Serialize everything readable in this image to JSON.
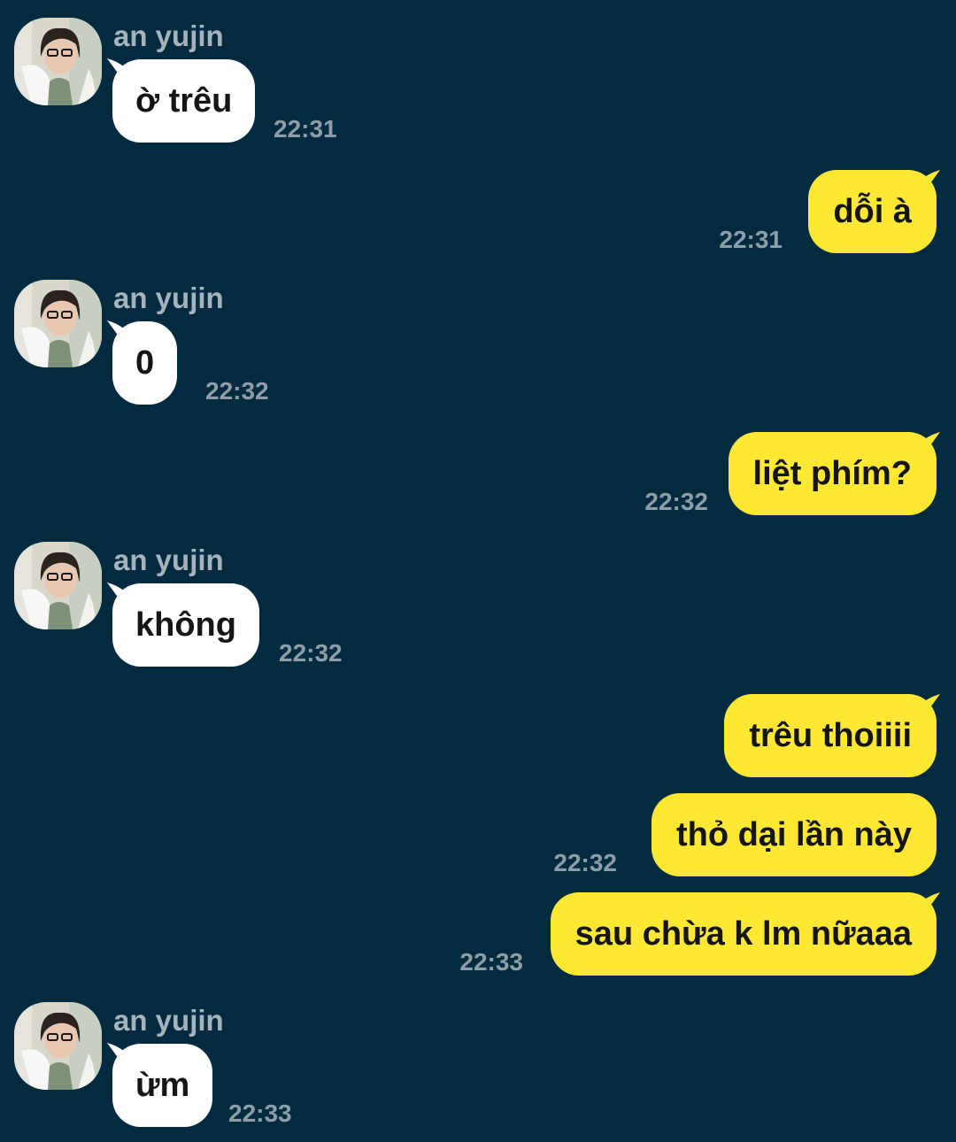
{
  "contact": {
    "name": "an yujin"
  },
  "colors": {
    "background": "#022b40",
    "incoming_bubble": "#ffffff",
    "outgoing_bubble": "#fee833",
    "timestamp": "#8d9ea9",
    "sender_name": "#a6b3bd"
  },
  "messages": [
    {
      "direction": "incoming",
      "sender": "an yujin",
      "text": "ờ trêu",
      "time": "22:31"
    },
    {
      "direction": "outgoing",
      "text": "dỗi à",
      "time": "22:31"
    },
    {
      "direction": "incoming",
      "sender": "an yujin",
      "text": "0",
      "time": "22:32"
    },
    {
      "direction": "outgoing",
      "text": "liệt phím?",
      "time": "22:32"
    },
    {
      "direction": "incoming",
      "sender": "an yujin",
      "text": "không",
      "time": "22:32"
    },
    {
      "direction": "outgoing",
      "text": "trêu thoiiii",
      "time": ""
    },
    {
      "direction": "outgoing",
      "text": "thỏ dại lần này",
      "time": "22:32"
    },
    {
      "direction": "outgoing",
      "text": "sau chừa k lm nữaaa",
      "time": "22:33"
    },
    {
      "direction": "incoming",
      "sender": "an yujin",
      "text": "ừm",
      "time": "22:33"
    }
  ]
}
